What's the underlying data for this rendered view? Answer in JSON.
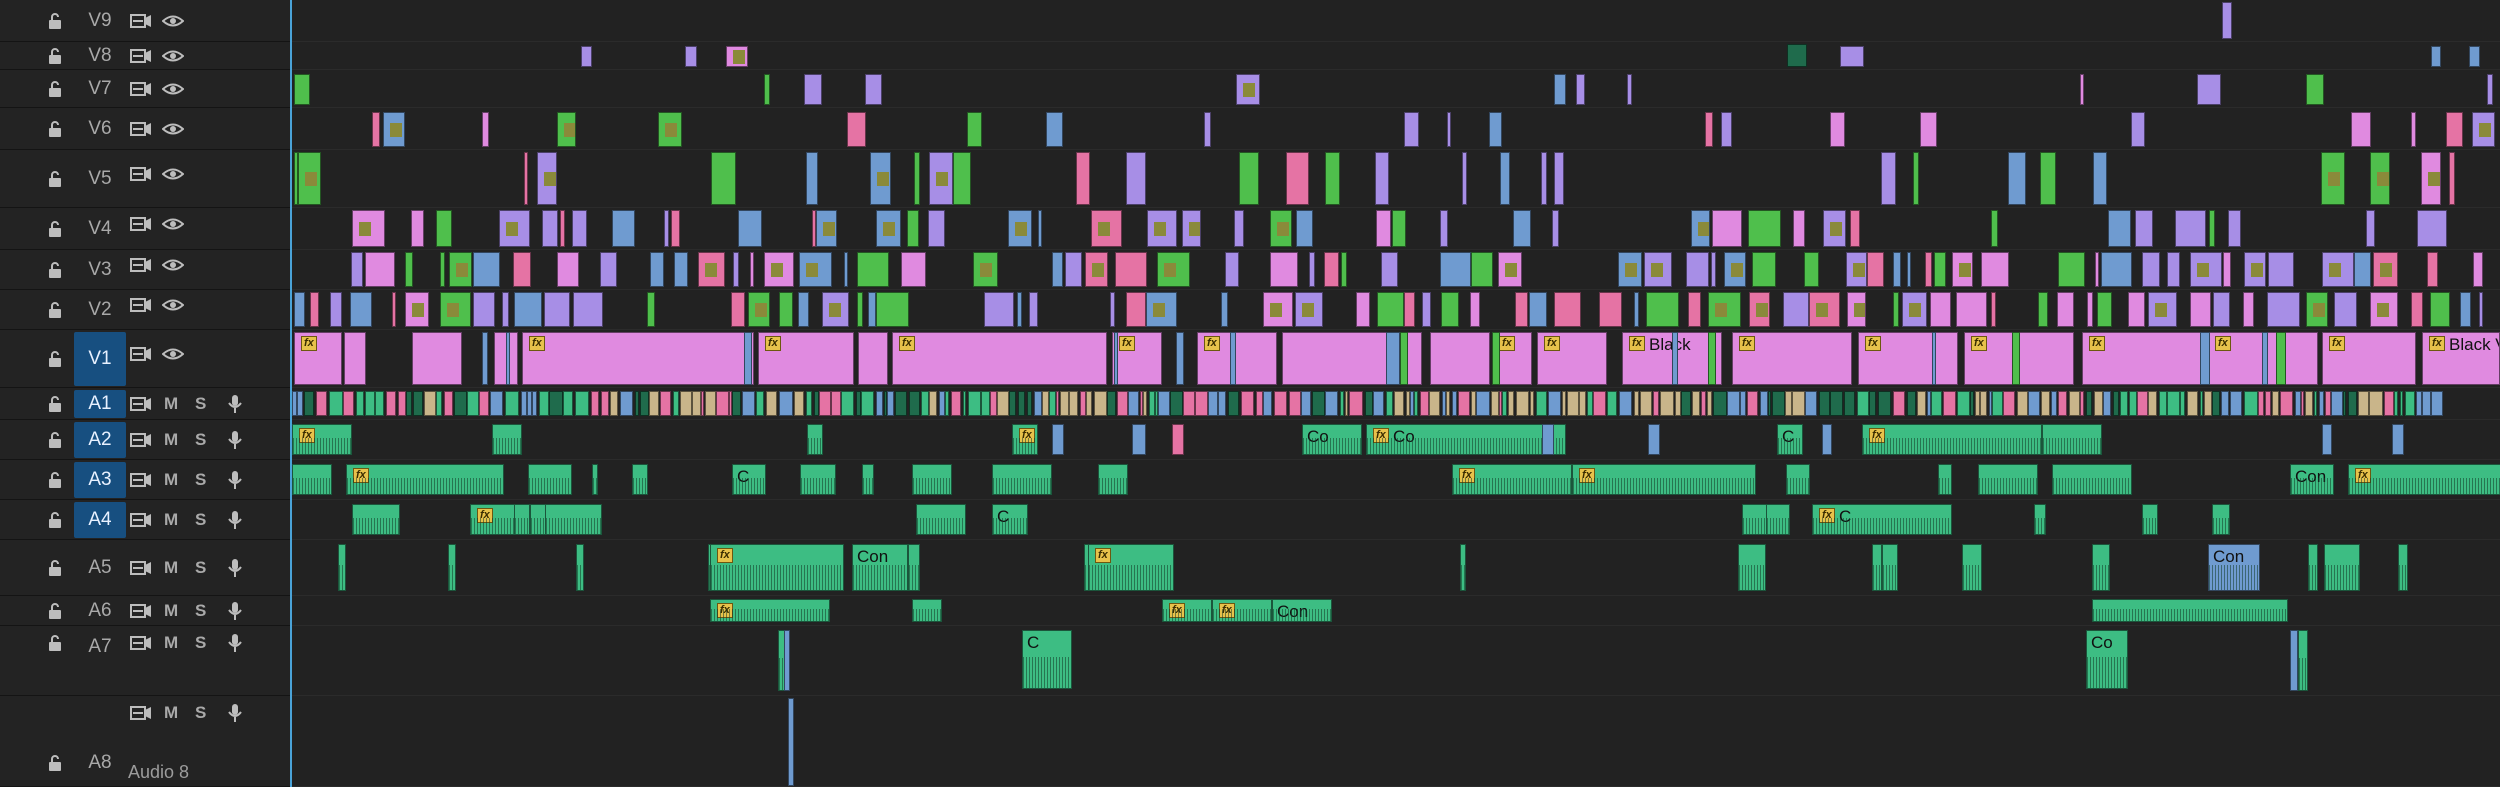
{
  "video_tracks": [
    {
      "id": "V9",
      "selected": false
    },
    {
      "id": "V8",
      "selected": false
    },
    {
      "id": "V7",
      "selected": false
    },
    {
      "id": "V6",
      "selected": false
    },
    {
      "id": "V5",
      "selected": false
    },
    {
      "id": "V4",
      "selected": false
    },
    {
      "id": "V3",
      "selected": false
    },
    {
      "id": "V2",
      "selected": false
    },
    {
      "id": "V1",
      "selected": true
    }
  ],
  "audio_tracks": [
    {
      "id": "A1",
      "selected": true,
      "mute_label": "M",
      "solo_label": "S"
    },
    {
      "id": "A2",
      "selected": true,
      "mute_label": "M",
      "solo_label": "S"
    },
    {
      "id": "A3",
      "selected": true,
      "mute_label": "M",
      "solo_label": "S"
    },
    {
      "id": "A4",
      "selected": true,
      "mute_label": "M",
      "solo_label": "S"
    },
    {
      "id": "A5",
      "selected": false,
      "mute_label": "M",
      "solo_label": "S"
    },
    {
      "id": "A6",
      "selected": false,
      "mute_label": "M",
      "solo_label": "S"
    },
    {
      "id": "A7",
      "selected": false,
      "mute_label": "M",
      "solo_label": "S"
    },
    {
      "id": "A8",
      "selected": false,
      "mute_label": "M",
      "solo_label": "S",
      "track_title": "Audio 8"
    }
  ],
  "clip_labels": {
    "fx": "fx",
    "black": "Black",
    "black_video": "Black Video",
    "con": "Con",
    "co": "Co",
    "c": "C"
  },
  "colors": {
    "panel_bg": "#232323",
    "lane_bg": "#222222",
    "track_patch": "#174f80",
    "playhead": "#4aa3d8",
    "clip_violet": "#e08ae0",
    "clip_lavender": "#a78ee6",
    "clip_steel_blue": "#6f9bd0",
    "clip_green": "#4fbf4c",
    "clip_audio_green": "#3dbd83",
    "clip_audio_dark": "#1f6b4c",
    "clip_pink": "#e573a4",
    "clip_tan": "#c9b58a",
    "fx_badge": "#e7c24b"
  },
  "icons": [
    "lock-icon",
    "toggle-output-icon",
    "eye-icon",
    "voiceover-record-icon",
    "mute-button",
    "solo-button"
  ]
}
